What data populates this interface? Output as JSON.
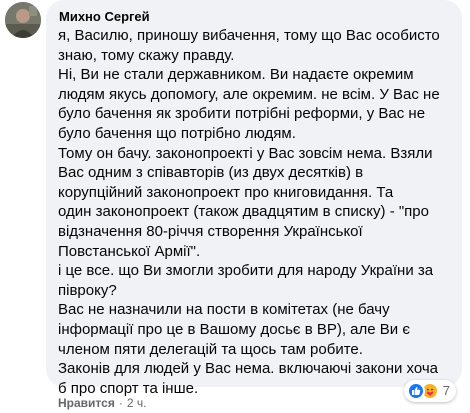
{
  "comment": {
    "author": "Михно Сергей",
    "lines": [
      "я, Василю, приношу вибачення, тому що Вас особисто",
      "знаю, тому скажу правду.",
      "Ні, Ви не стали державником. Ви надаєте окремим",
      "людям якусь допомогу, але окремим. не всім. У Вас не",
      "було бачення як зробити потрібні реформи, у Вас не",
      "було бачення що потрібно людям.",
      "Тому он бачу. законопроекті у Вас зовсім нема. Взяли",
      "Вас одним з співавторів (из двух десятків) в",
      "корупційний законопроект про книговидання. Та",
      "один законопроект (також двадцятим в списку) - \"про",
      "відзначення 80-річчя створення Української",
      "Повстанської Армії\".",
      "і це все. що Ви змогли зробити для народу України за",
      "півроку?",
      "Вас не назначили на пости в комітетах (не бачу",
      "інформації про це в Вашому досьє в ВР), але Ви є",
      "членом пяти делегацій та щось там робите.",
      "Законів для людей у Вас нема. включаючі закони хоча",
      "б про спорт та інше."
    ],
    "reactions": {
      "icons": [
        "like-icon",
        "care-icon"
      ],
      "count": "7"
    },
    "actions": {
      "like_label": "Нравится",
      "separator": "·",
      "time": "2 ч."
    }
  }
}
